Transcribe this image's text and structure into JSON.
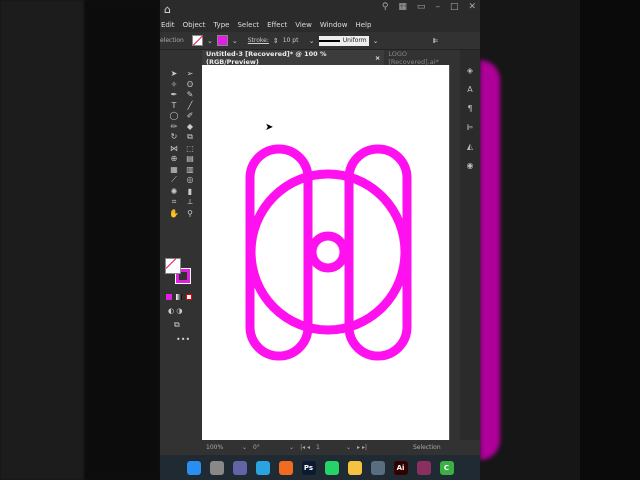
{
  "app": {
    "title_icons": [
      "home-icon",
      "search-icon",
      "arrange-icon",
      "workspace-icon",
      "minimize-icon",
      "maximize-icon",
      "close-icon"
    ]
  },
  "menu": [
    "Edit",
    "Object",
    "Type",
    "Select",
    "Effect",
    "View",
    "Window",
    "Help"
  ],
  "control": {
    "mode": "election",
    "stroke_label": "Stroke:",
    "stroke_value": "10 pt",
    "profile": "Uniform"
  },
  "tabs": [
    {
      "label": "Untitled-3 [Recovered]* @ 100 % (RGB/Preview)",
      "close": "×"
    },
    {
      "label": "LOGO [Recovered].ai*"
    }
  ],
  "status": {
    "zoom": "100%",
    "rotate": "0°",
    "artboard": "1",
    "tool": "Selection"
  },
  "colors": {
    "shape": "#ff10ef",
    "accent": "#e020e0"
  },
  "taskbar": [
    {
      "name": "windows-start",
      "label": "",
      "color": "#2a8df0"
    },
    {
      "name": "task-view",
      "label": "",
      "color": "#888"
    },
    {
      "name": "teams",
      "label": "",
      "color": "#6264a7"
    },
    {
      "name": "telegram",
      "label": "",
      "color": "#2aa3e0"
    },
    {
      "name": "firefox",
      "label": "",
      "color": "#f36b21"
    },
    {
      "name": "photoshop",
      "label": "Ps",
      "color": "#0b1a33"
    },
    {
      "name": "whatsapp",
      "label": "",
      "color": "#25d366"
    },
    {
      "name": "file-explorer",
      "label": "",
      "color": "#f5c242"
    },
    {
      "name": "settings",
      "label": "",
      "color": "#5a6c80"
    },
    {
      "name": "illustrator",
      "label": "Ai",
      "color": "#330000"
    },
    {
      "name": "winrar",
      "label": "",
      "color": "#8a3060"
    },
    {
      "name": "camtasia",
      "label": "C",
      "color": "#3cb043"
    }
  ]
}
